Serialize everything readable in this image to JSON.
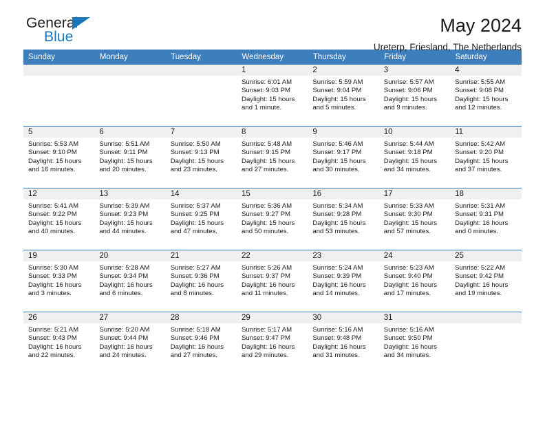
{
  "brand": {
    "line1": "General",
    "line2": "Blue",
    "accent_color": "#1b75bb",
    "triangle_icon": "triangle-icon"
  },
  "header": {
    "title": "May 2024",
    "subtitle": "Ureterp, Friesland, The Netherlands"
  },
  "calendar": {
    "header_color": "#3d7ebc",
    "daynum_strip_color": "#f0f0f0",
    "weekdays": [
      "Sunday",
      "Monday",
      "Tuesday",
      "Wednesday",
      "Thursday",
      "Friday",
      "Saturday"
    ],
    "labels": {
      "sunrise": "Sunrise:",
      "sunset": "Sunset:",
      "daylight": "Daylight:"
    },
    "weeks": [
      [
        {
          "day": "",
          "empty": true
        },
        {
          "day": "",
          "empty": true
        },
        {
          "day": "",
          "empty": true
        },
        {
          "day": "1",
          "sunrise": "Sunrise: 6:01 AM",
          "sunset": "Sunset: 9:03 PM",
          "daylight": "Daylight: 15 hours and 1 minute."
        },
        {
          "day": "2",
          "sunrise": "Sunrise: 5:59 AM",
          "sunset": "Sunset: 9:04 PM",
          "daylight": "Daylight: 15 hours and 5 minutes."
        },
        {
          "day": "3",
          "sunrise": "Sunrise: 5:57 AM",
          "sunset": "Sunset: 9:06 PM",
          "daylight": "Daylight: 15 hours and 9 minutes."
        },
        {
          "day": "4",
          "sunrise": "Sunrise: 5:55 AM",
          "sunset": "Sunset: 9:08 PM",
          "daylight": "Daylight: 15 hours and 12 minutes."
        }
      ],
      [
        {
          "day": "5",
          "sunrise": "Sunrise: 5:53 AM",
          "sunset": "Sunset: 9:10 PM",
          "daylight": "Daylight: 15 hours and 16 minutes."
        },
        {
          "day": "6",
          "sunrise": "Sunrise: 5:51 AM",
          "sunset": "Sunset: 9:11 PM",
          "daylight": "Daylight: 15 hours and 20 minutes."
        },
        {
          "day": "7",
          "sunrise": "Sunrise: 5:50 AM",
          "sunset": "Sunset: 9:13 PM",
          "daylight": "Daylight: 15 hours and 23 minutes."
        },
        {
          "day": "8",
          "sunrise": "Sunrise: 5:48 AM",
          "sunset": "Sunset: 9:15 PM",
          "daylight": "Daylight: 15 hours and 27 minutes."
        },
        {
          "day": "9",
          "sunrise": "Sunrise: 5:46 AM",
          "sunset": "Sunset: 9:17 PM",
          "daylight": "Daylight: 15 hours and 30 minutes."
        },
        {
          "day": "10",
          "sunrise": "Sunrise: 5:44 AM",
          "sunset": "Sunset: 9:18 PM",
          "daylight": "Daylight: 15 hours and 34 minutes."
        },
        {
          "day": "11",
          "sunrise": "Sunrise: 5:42 AM",
          "sunset": "Sunset: 9:20 PM",
          "daylight": "Daylight: 15 hours and 37 minutes."
        }
      ],
      [
        {
          "day": "12",
          "sunrise": "Sunrise: 5:41 AM",
          "sunset": "Sunset: 9:22 PM",
          "daylight": "Daylight: 15 hours and 40 minutes."
        },
        {
          "day": "13",
          "sunrise": "Sunrise: 5:39 AM",
          "sunset": "Sunset: 9:23 PM",
          "daylight": "Daylight: 15 hours and 44 minutes."
        },
        {
          "day": "14",
          "sunrise": "Sunrise: 5:37 AM",
          "sunset": "Sunset: 9:25 PM",
          "daylight": "Daylight: 15 hours and 47 minutes."
        },
        {
          "day": "15",
          "sunrise": "Sunrise: 5:36 AM",
          "sunset": "Sunset: 9:27 PM",
          "daylight": "Daylight: 15 hours and 50 minutes."
        },
        {
          "day": "16",
          "sunrise": "Sunrise: 5:34 AM",
          "sunset": "Sunset: 9:28 PM",
          "daylight": "Daylight: 15 hours and 53 minutes."
        },
        {
          "day": "17",
          "sunrise": "Sunrise: 5:33 AM",
          "sunset": "Sunset: 9:30 PM",
          "daylight": "Daylight: 15 hours and 57 minutes."
        },
        {
          "day": "18",
          "sunrise": "Sunrise: 5:31 AM",
          "sunset": "Sunset: 9:31 PM",
          "daylight": "Daylight: 16 hours and 0 minutes."
        }
      ],
      [
        {
          "day": "19",
          "sunrise": "Sunrise: 5:30 AM",
          "sunset": "Sunset: 9:33 PM",
          "daylight": "Daylight: 16 hours and 3 minutes."
        },
        {
          "day": "20",
          "sunrise": "Sunrise: 5:28 AM",
          "sunset": "Sunset: 9:34 PM",
          "daylight": "Daylight: 16 hours and 6 minutes."
        },
        {
          "day": "21",
          "sunrise": "Sunrise: 5:27 AM",
          "sunset": "Sunset: 9:36 PM",
          "daylight": "Daylight: 16 hours and 8 minutes."
        },
        {
          "day": "22",
          "sunrise": "Sunrise: 5:26 AM",
          "sunset": "Sunset: 9:37 PM",
          "daylight": "Daylight: 16 hours and 11 minutes."
        },
        {
          "day": "23",
          "sunrise": "Sunrise: 5:24 AM",
          "sunset": "Sunset: 9:39 PM",
          "daylight": "Daylight: 16 hours and 14 minutes."
        },
        {
          "day": "24",
          "sunrise": "Sunrise: 5:23 AM",
          "sunset": "Sunset: 9:40 PM",
          "daylight": "Daylight: 16 hours and 17 minutes."
        },
        {
          "day": "25",
          "sunrise": "Sunrise: 5:22 AM",
          "sunset": "Sunset: 9:42 PM",
          "daylight": "Daylight: 16 hours and 19 minutes."
        }
      ],
      [
        {
          "day": "26",
          "sunrise": "Sunrise: 5:21 AM",
          "sunset": "Sunset: 9:43 PM",
          "daylight": "Daylight: 16 hours and 22 minutes."
        },
        {
          "day": "27",
          "sunrise": "Sunrise: 5:20 AM",
          "sunset": "Sunset: 9:44 PM",
          "daylight": "Daylight: 16 hours and 24 minutes."
        },
        {
          "day": "28",
          "sunrise": "Sunrise: 5:18 AM",
          "sunset": "Sunset: 9:46 PM",
          "daylight": "Daylight: 16 hours and 27 minutes."
        },
        {
          "day": "29",
          "sunrise": "Sunrise: 5:17 AM",
          "sunset": "Sunset: 9:47 PM",
          "daylight": "Daylight: 16 hours and 29 minutes."
        },
        {
          "day": "30",
          "sunrise": "Sunrise: 5:16 AM",
          "sunset": "Sunset: 9:48 PM",
          "daylight": "Daylight: 16 hours and 31 minutes."
        },
        {
          "day": "31",
          "sunrise": "Sunrise: 5:16 AM",
          "sunset": "Sunset: 9:50 PM",
          "daylight": "Daylight: 16 hours and 34 minutes."
        },
        {
          "day": "",
          "empty": true
        }
      ]
    ]
  }
}
